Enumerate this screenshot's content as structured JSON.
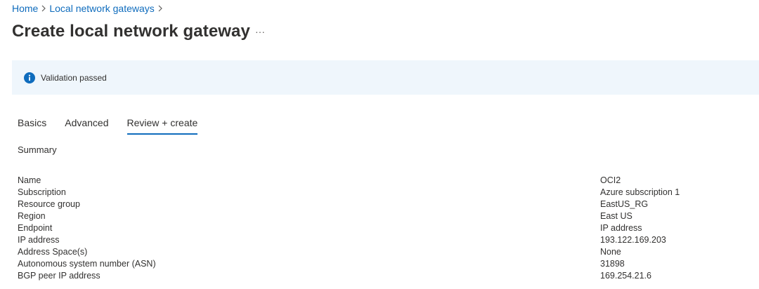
{
  "breadcrumb": {
    "items": [
      {
        "label": "Home"
      },
      {
        "label": "Local network gateways"
      }
    ]
  },
  "page": {
    "title": "Create local network gateway",
    "more_label": "···"
  },
  "banner": {
    "message": "Validation passed",
    "icon": "info-icon",
    "color": "#0f6cbd",
    "background": "#eff6fc"
  },
  "tabs": [
    {
      "label": "Basics",
      "active": false
    },
    {
      "label": "Advanced",
      "active": false
    },
    {
      "label": "Review + create",
      "active": true
    }
  ],
  "summary": {
    "heading": "Summary",
    "rows": [
      {
        "label": "Name",
        "value": "OCI2"
      },
      {
        "label": "Subscription",
        "value": "Azure subscription 1"
      },
      {
        "label": "Resource group",
        "value": "EastUS_RG"
      },
      {
        "label": "Region",
        "value": "East US"
      },
      {
        "label": "Endpoint",
        "value": "IP address"
      },
      {
        "label": "IP address",
        "value": "193.122.169.203"
      },
      {
        "label": "Address Space(s)",
        "value": "None"
      },
      {
        "label": "Autonomous system number (ASN)",
        "value": "31898"
      },
      {
        "label": "BGP peer IP address",
        "value": "169.254.21.6"
      }
    ]
  },
  "colors": {
    "accent": "#0f6cbd",
    "text": "#323130"
  }
}
